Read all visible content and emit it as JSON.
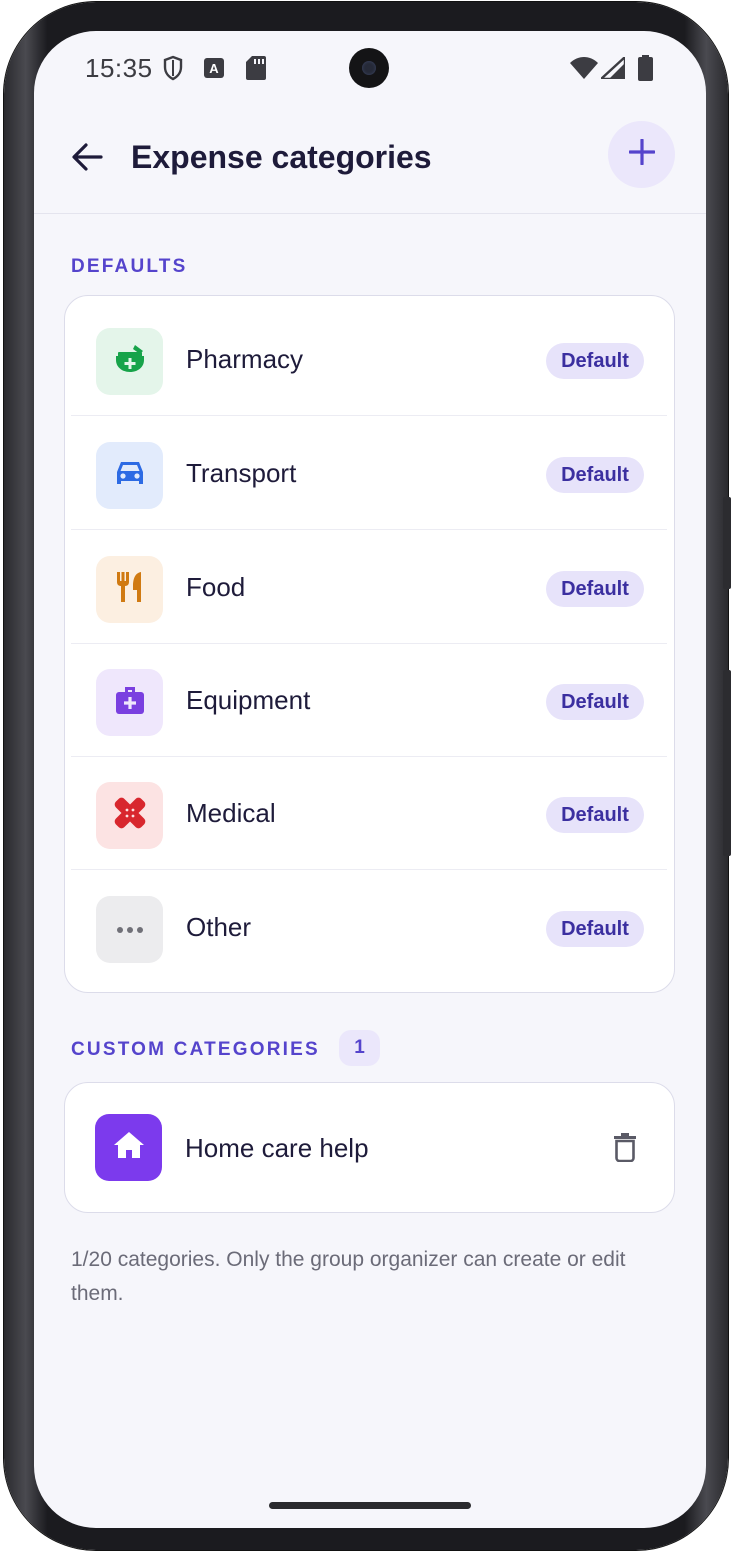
{
  "status_bar": {
    "time": "15:35",
    "left_icons": [
      "shield-icon",
      "font-a-icon",
      "sd-card-icon"
    ],
    "right_icons": [
      "wifi-icon",
      "signal-icon",
      "battery-icon"
    ]
  },
  "header": {
    "title": "Expense categories",
    "back_icon": "arrow-left-icon",
    "add_icon": "plus-icon"
  },
  "defaults_section": {
    "label": "DEFAULTS",
    "items": [
      {
        "name": "Pharmacy",
        "badge": "Default",
        "icon": "mortar-pestle-icon",
        "icon_color": "#17a34a",
        "icon_bg": "#e4f5ea"
      },
      {
        "name": "Transport",
        "badge": "Default",
        "icon": "car-icon",
        "icon_color": "#2d6be4",
        "icon_bg": "#e2ebfc"
      },
      {
        "name": "Food",
        "badge": "Default",
        "icon": "fork-knife-icon",
        "icon_color": "#d07a12",
        "icon_bg": "#fcefe1"
      },
      {
        "name": "Equipment",
        "badge": "Default",
        "icon": "medical-kit-icon",
        "icon_color": "#7a3fe0",
        "icon_bg": "#efe7fc"
      },
      {
        "name": "Medical",
        "badge": "Default",
        "icon": "bandage-icon",
        "icon_color": "#d8272e",
        "icon_bg": "#fce3e3"
      },
      {
        "name": "Other",
        "badge": "Default",
        "icon": "more-horizontal-icon",
        "icon_color": "#707078",
        "icon_bg": "#ececee"
      }
    ]
  },
  "custom_section": {
    "label": "CUSTOM CATEGORIES",
    "count": "1",
    "items": [
      {
        "name": "Home care help",
        "icon": "home-icon",
        "icon_color": "#ffffff",
        "icon_bg": "#7c3aed",
        "action_icon": "trash-icon"
      }
    ]
  },
  "footnote": "1/20 categories. Only the group organizer can create or edit them.",
  "colors": {
    "accent": "#5544cc",
    "title_text": "#1e1b3a",
    "background": "#f6f6fb"
  }
}
